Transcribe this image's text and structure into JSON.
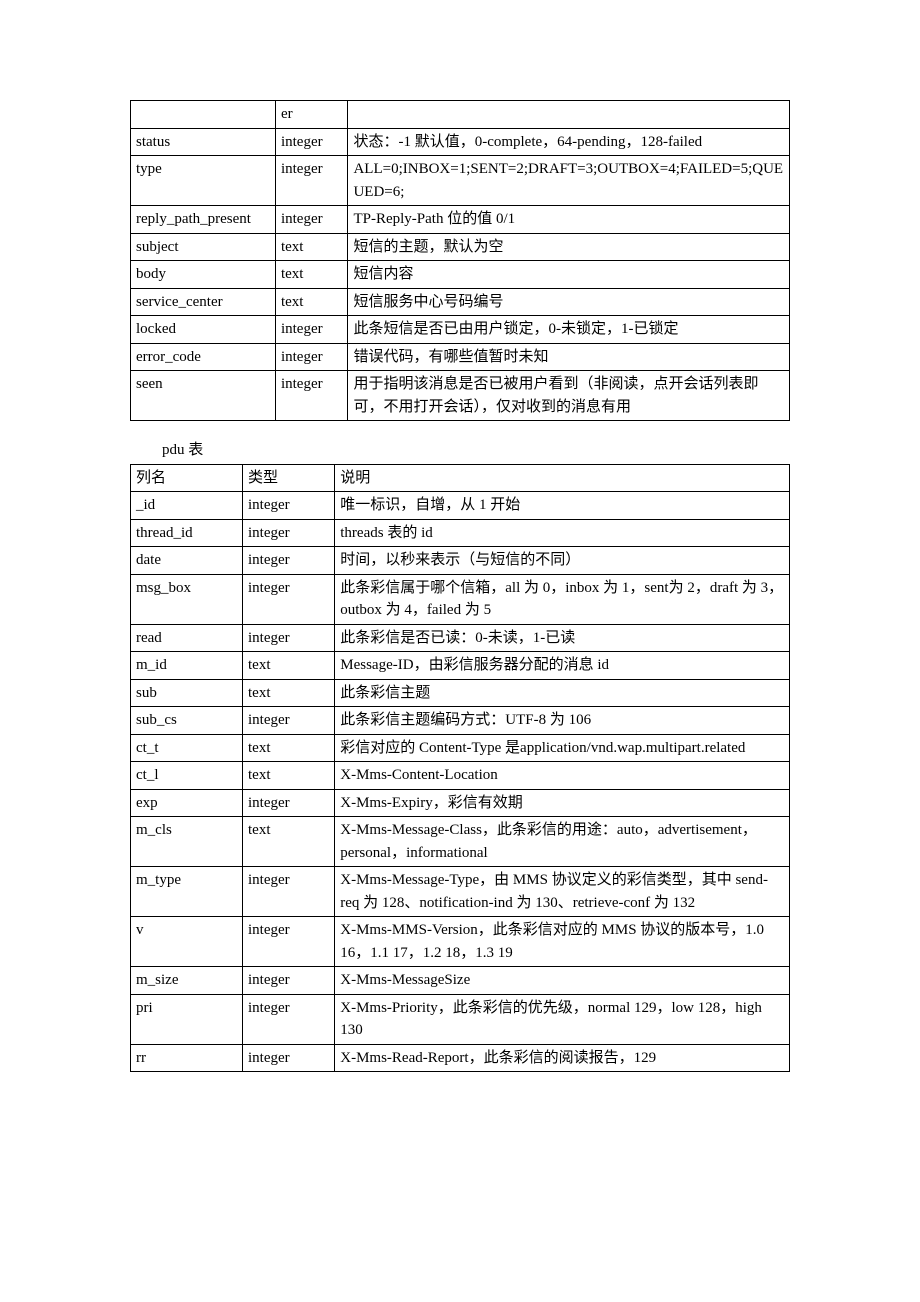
{
  "table1": {
    "rows": [
      {
        "name": "",
        "type": "er",
        "desc": ""
      },
      {
        "name": "status",
        "type": "integer",
        "desc": "状态：-1 默认值，0-complete，64-pending，128-failed"
      },
      {
        "name": "type",
        "type": "integer",
        "desc": "ALL=0;INBOX=1;SENT=2;DRAFT=3;OUTBOX=4;FAILED=5;QUEUED=6;"
      },
      {
        "name": "reply_path_present",
        "type": "integer",
        "desc": "TP-Reply-Path 位的值 0/1"
      },
      {
        "name": "subject",
        "type": "text",
        "desc": "短信的主题，默认为空"
      },
      {
        "name": "body",
        "type": "text",
        "desc": "短信内容"
      },
      {
        "name": "service_center",
        "type": "text",
        "desc": "短信服务中心号码编号"
      },
      {
        "name": "locked",
        "type": "integer",
        "desc": "此条短信是否已由用户锁定，0-未锁定，1-已锁定"
      },
      {
        "name": "error_code",
        "type": "integer",
        "desc": "错误代码，有哪些值暂时未知"
      },
      {
        "name": "seen",
        "type": "integer",
        "desc": "用于指明该消息是否已被用户看到（非阅读，点开会话列表即可，不用打开会话），仅对收到的消息有用"
      }
    ]
  },
  "table2": {
    "title": "pdu 表",
    "header": {
      "name": "列名",
      "type": "类型",
      "desc": "说明"
    },
    "rows": [
      {
        "name": "_id",
        "type": "integer",
        "desc": "唯一标识，自增，从 1 开始"
      },
      {
        "name": "thread_id",
        "type": "integer",
        "desc": "threads 表的 id"
      },
      {
        "name": "date",
        "type": "integer",
        "desc": "时间，以秒来表示（与短信的不同）"
      },
      {
        "name": "msg_box",
        "type": "integer",
        "desc": "此条彩信属于哪个信箱，all 为 0，inbox 为 1，sent为 2，draft 为 3，outbox 为 4，failed 为 5"
      },
      {
        "name": "read",
        "type": "integer",
        "desc": "此条彩信是否已读：0-未读，1-已读"
      },
      {
        "name": "m_id",
        "type": "text",
        "desc": "Message-ID，由彩信服务器分配的消息 id"
      },
      {
        "name": "sub",
        "type": "text",
        "desc": "此条彩信主题"
      },
      {
        "name": "sub_cs",
        "type": "integer",
        "desc": "此条彩信主题编码方式：UTF-8 为 106"
      },
      {
        "name": "ct_t",
        "type": "text",
        "desc": "彩信对应的 Content-Type 是application/vnd.wap.multipart.related"
      },
      {
        "name": "ct_l",
        "type": "text",
        "desc": "X-Mms-Content-Location"
      },
      {
        "name": "exp",
        "type": "integer",
        "desc": "X-Mms-Expiry，彩信有效期"
      },
      {
        "name": "m_cls",
        "type": "text",
        "desc": "X-Mms-Message-Class，此条彩信的用途：auto，advertisement，personal，informational"
      },
      {
        "name": "m_type",
        "type": "integer",
        "desc": "X-Mms-Message-Type，由 MMS 协议定义的彩信类型，其中 send-req 为 128、notification-ind 为 130、retrieve-conf 为 132"
      },
      {
        "name": "v",
        "type": "integer",
        "desc": "X-Mms-MMS-Version，此条彩信对应的 MMS 协议的版本号，1.0 16，1.1 17，1.2 18，1.3 19"
      },
      {
        "name": "m_size",
        "type": "integer",
        "desc": "X-Mms-MessageSize"
      },
      {
        "name": "pri",
        "type": "integer",
        "desc": "X-Mms-Priority，此条彩信的优先级，normal 129，low 128，high 130"
      },
      {
        "name": "rr",
        "type": "integer",
        "desc": "X-Mms-Read-Report，此条彩信的阅读报告，129"
      }
    ]
  }
}
